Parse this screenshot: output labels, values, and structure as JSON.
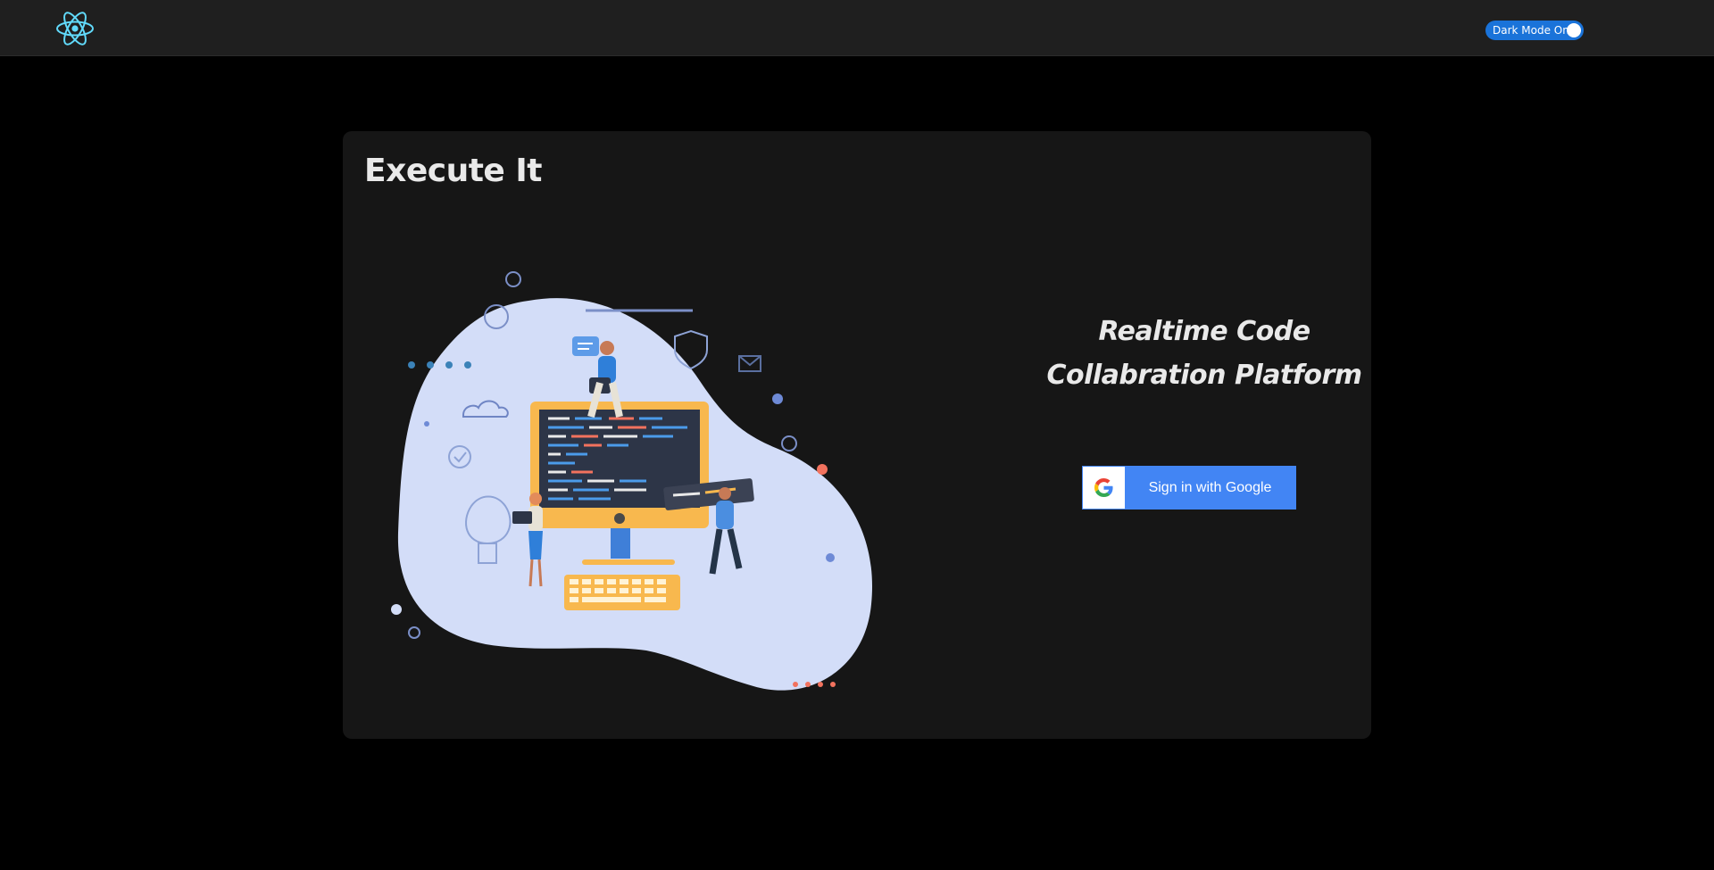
{
  "navbar": {
    "logo_icon": "react-atom-icon",
    "dark_mode_toggle": {
      "label": "Dark Mode On",
      "on": true,
      "color": "#1a73d9"
    }
  },
  "card": {
    "title": "Execute It",
    "illustration_icon": "developers-collaboration-illustration",
    "tagline_line1": "Realtime Code",
    "tagline_line2": "Collabration Platform",
    "signin_button": {
      "label": "Sign in with Google",
      "icon": "google-g-icon",
      "color": "#4285f4"
    }
  }
}
